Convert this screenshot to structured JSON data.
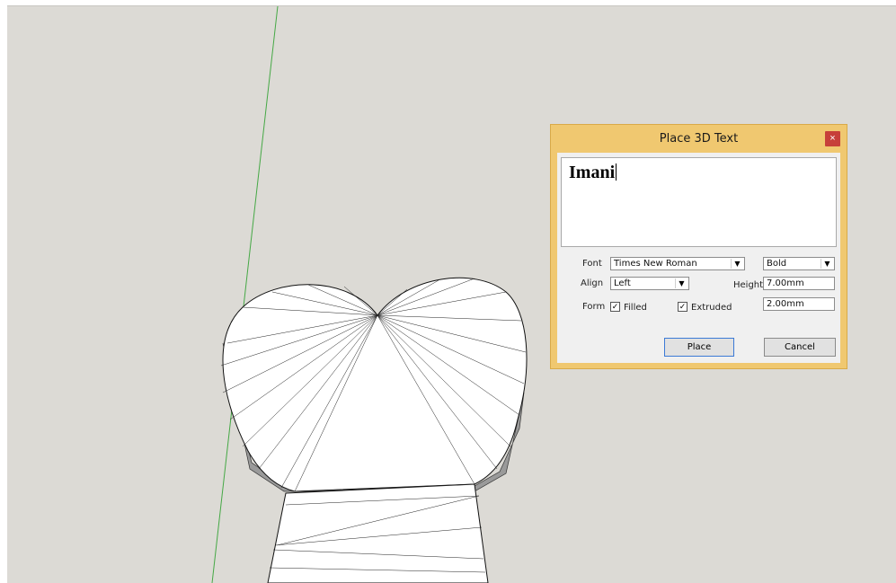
{
  "dialog": {
    "title": "Place 3D Text",
    "close_label": "×",
    "text_value": "Imani",
    "font_label": "Font",
    "font_value": "Times New Roman",
    "style_value": "Bold",
    "align_label": "Align",
    "align_value": "Left",
    "height_label": "Height",
    "height_value": "7.00mm",
    "form_label": "Form",
    "filled_label": "Filled",
    "filled_checked": "✓",
    "extruded_label": "Extruded",
    "extruded_checked": "✓",
    "extrusion_value": "2.00mm",
    "place_label": "Place",
    "cancel_label": "Cancel"
  },
  "colors": {
    "viewport_bg": "#dcdad5",
    "green_axis": "#45a845",
    "dialog_frame": "#f0c870",
    "close_button": "#c7403a"
  }
}
